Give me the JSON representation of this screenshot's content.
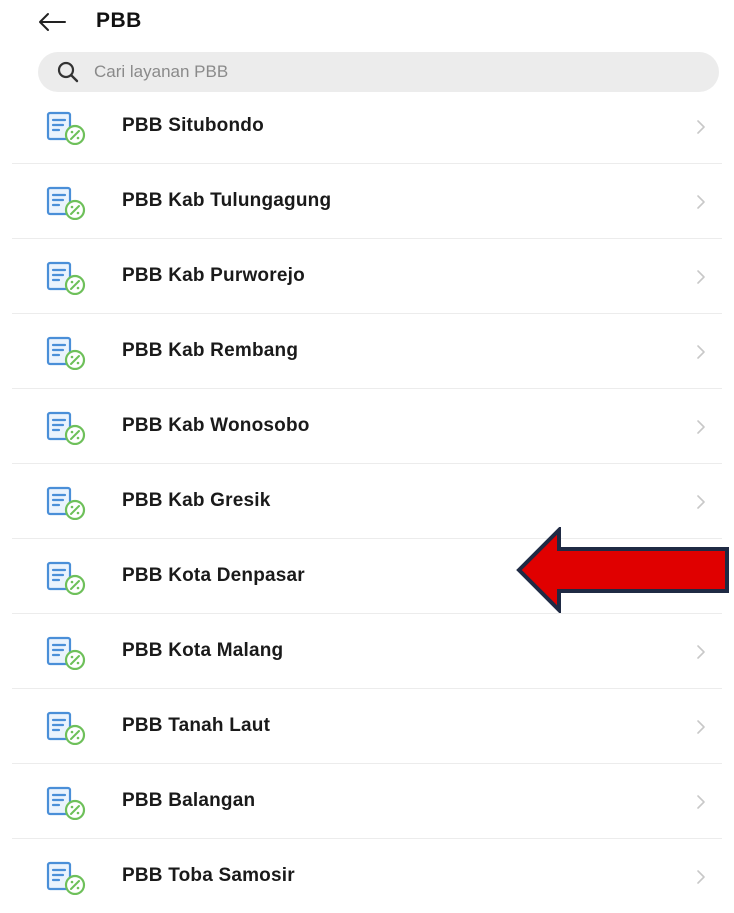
{
  "header": {
    "back_icon": "arrow-left-icon",
    "title": "PBB"
  },
  "search": {
    "icon": "search-icon",
    "placeholder": "Cari layanan PBB"
  },
  "list": {
    "item_icon": "tax-document-icon",
    "chevron_icon": "chevron-right-icon",
    "items": [
      {
        "label": "PBB Situbondo"
      },
      {
        "label": "PBB Kab Tulungagung"
      },
      {
        "label": "PBB Kab Purworejo"
      },
      {
        "label": "PBB Kab Rembang"
      },
      {
        "label": "PBB Kab Wonosobo"
      },
      {
        "label": "PBB Kab Gresik"
      },
      {
        "label": "PBB Kota Denpasar"
      },
      {
        "label": "PBB Kota Malang"
      },
      {
        "label": "PBB Tanah Laut"
      },
      {
        "label": "PBB Balangan"
      },
      {
        "label": "PBB Toba Samosir"
      }
    ]
  },
  "annotation": {
    "icon": "red-arrow-left-icon",
    "color": "#e00000",
    "points_to_item": "PBB Kota Denpasar"
  },
  "colors": {
    "icon_blue": "#4a8fd8",
    "icon_green": "#6ec05a",
    "divider": "#ececec",
    "search_bg": "#ececec"
  }
}
